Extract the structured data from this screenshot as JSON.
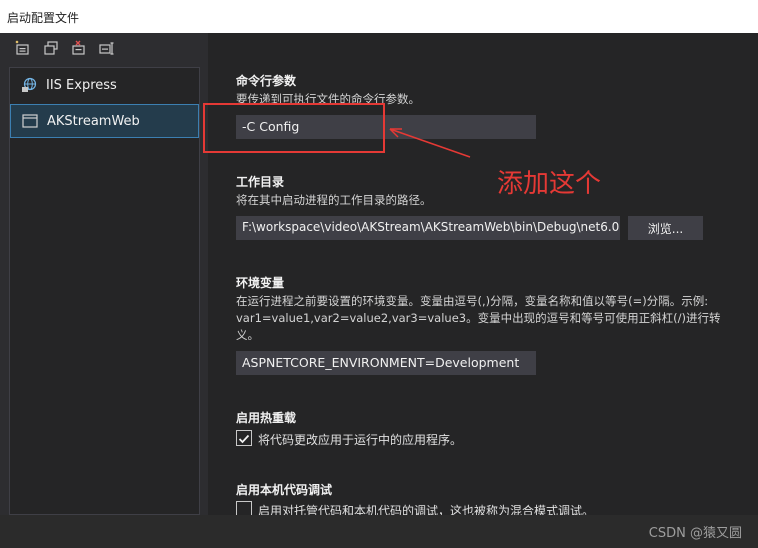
{
  "window": {
    "title": "启动配置文件"
  },
  "sidebar": {
    "toolbar_icons": [
      "new-profile-icon",
      "copy-profile-icon",
      "delete-profile-icon",
      "rename-profile-icon"
    ],
    "profiles": [
      {
        "label": "IIS Express",
        "icon": "globe-icon",
        "selected": false
      },
      {
        "label": "AKStreamWeb",
        "icon": "window-icon",
        "selected": true
      }
    ]
  },
  "main": {
    "cmd_args": {
      "title": "命令行参数",
      "desc": "要传递到可执行文件的命令行参数。",
      "value": "-C Config"
    },
    "working_dir": {
      "title": "工作目录",
      "desc": "将在其中启动进程的工作目录的路径。",
      "value": "F:\\workspace\\video\\AKStream\\AKStreamWeb\\bin\\Debug\\net6.0",
      "browse_label": "浏览..."
    },
    "env_vars": {
      "title": "环境变量",
      "desc_line1": "在运行进程之前要设置的环境变量。变量由逗号(,)分隔，变量名称和值以等号(=)分隔。示例:",
      "desc_line2": "var1=value1,var2=value2,var3=value3。变量中出现的逗号和等号可使用正斜杠(/)进行转",
      "desc_line3": "义。",
      "value": "ASPNETCORE_ENVIRONMENT=Development"
    },
    "hot_reload": {
      "title": "启用热重载",
      "checkbox_label": "将代码更改应用于运行中的应用程序。",
      "checked": true
    },
    "native_debug": {
      "title": "启用本机代码调试",
      "checkbox_label": "启用对托管代码和本机代码的调试，这也被称为混合模式调试。",
      "checked": false
    }
  },
  "annotation": {
    "text": "添加这个",
    "color": "#e53935"
  },
  "watermark": "CSDN @猿又圆"
}
